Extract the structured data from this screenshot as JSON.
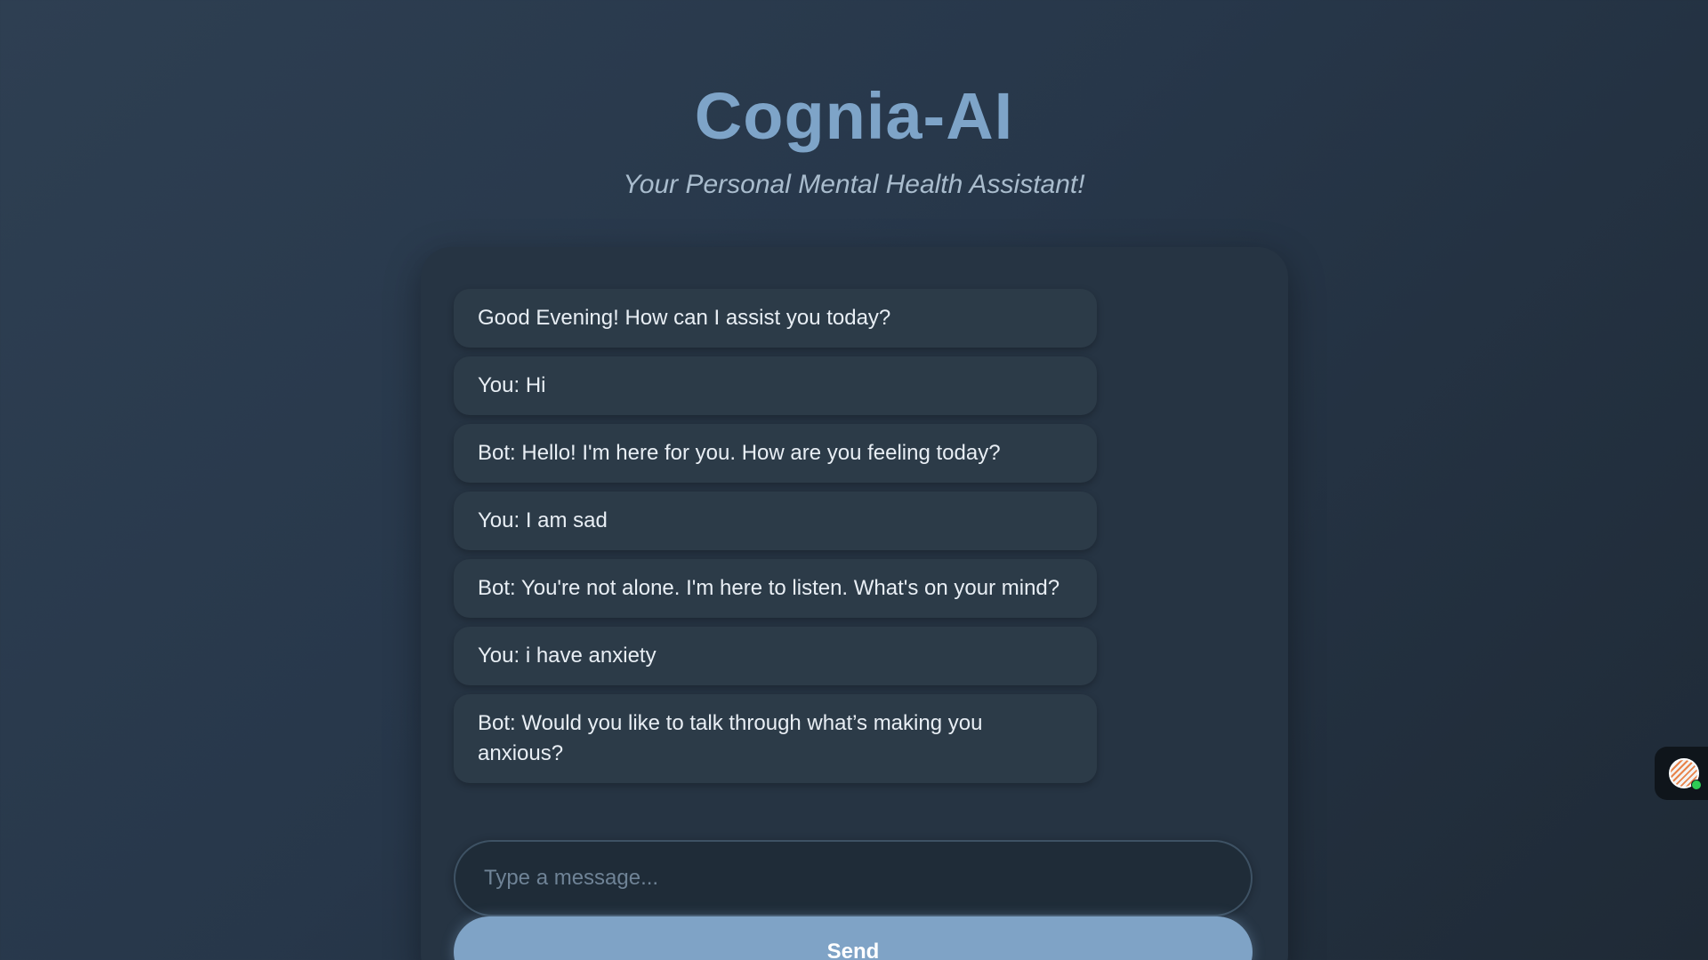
{
  "header": {
    "title": "Cognia-AI",
    "subtitle": "Your Personal Mental Health Assistant!"
  },
  "chat": {
    "messages": [
      "Good Evening! How can I assist you today?",
      "You: Hi",
      "Bot: Hello! I'm here for you. How are you feeling today?",
      "You: I am sad",
      "Bot: You're not alone. I'm here to listen. What's on your mind?",
      "You: i have anxiety",
      "Bot: Would you like to talk through what’s making you anxious?"
    ]
  },
  "composer": {
    "placeholder": "Type a message...",
    "value": "",
    "send_label": "Send"
  },
  "widget": {
    "icon": "assistant-avatar-icon",
    "status_color": "#2ecc55"
  },
  "colors": {
    "accent": "#7fa3c6",
    "title": "#7ea4c8",
    "background": "#27374a",
    "bubble": "#2c3b48"
  }
}
